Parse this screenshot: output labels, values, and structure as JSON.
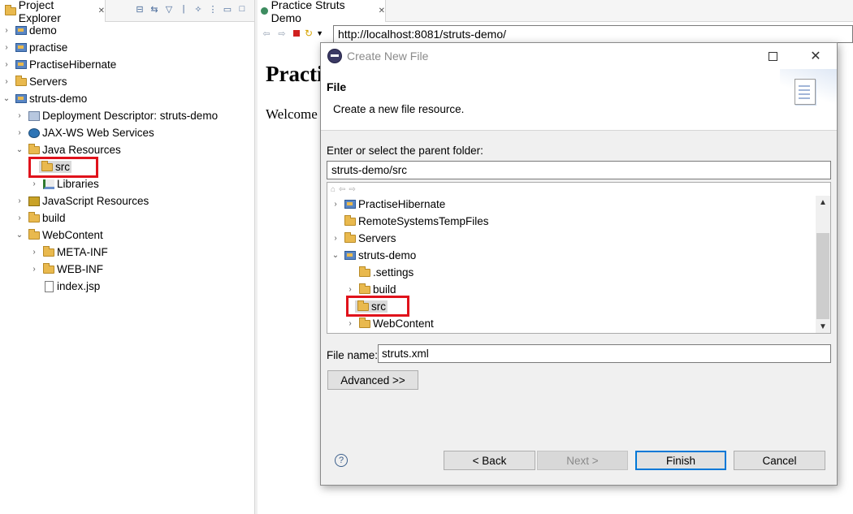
{
  "explorer": {
    "tab_label": "Project Explorer",
    "tab_close": "✕",
    "items": [
      {
        "label": "demo",
        "twisty": "›",
        "icon": "project-icon"
      },
      {
        "label": "practise",
        "twisty": "›",
        "icon": "project-icon"
      },
      {
        "label": "PractiseHibernate",
        "twisty": "›",
        "icon": "project-icon"
      },
      {
        "label": "Servers",
        "twisty": "›",
        "icon": "folder-icon"
      },
      {
        "label": "struts-demo",
        "twisty": "⌄",
        "icon": "project-icon"
      },
      {
        "label": "Deployment Descriptor: struts-demo",
        "twisty": "›",
        "icon": "deployment-descriptor-icon"
      },
      {
        "label": "JAX-WS Web Services",
        "twisty": "›",
        "icon": "web-services-icon"
      },
      {
        "label": "Java Resources",
        "twisty": "⌄",
        "icon": "java-resources-icon"
      },
      {
        "label": "src",
        "twisty": "",
        "icon": "source-folder-icon"
      },
      {
        "label": "Libraries",
        "twisty": "›",
        "icon": "libraries-icon"
      },
      {
        "label": "JavaScript Resources",
        "twisty": "›",
        "icon": "javascript-resources-icon"
      },
      {
        "label": "build",
        "twisty": "›",
        "icon": "folder-icon"
      },
      {
        "label": "WebContent",
        "twisty": "⌄",
        "icon": "folder-icon"
      },
      {
        "label": "META-INF",
        "twisty": "›",
        "icon": "folder-icon"
      },
      {
        "label": "WEB-INF",
        "twisty": "›",
        "icon": "folder-icon"
      },
      {
        "label": "index.jsp",
        "twisty": "",
        "icon": "jsp-file-icon"
      }
    ]
  },
  "browser": {
    "tab_label": "Practice Struts Demo",
    "tab_close": "✕",
    "url": "http://localhost:8081/struts-demo/",
    "page_heading": "Practic",
    "page_text": "Welcome"
  },
  "dialog": {
    "title": "Create New File",
    "banner_title": "File",
    "banner_message": "Create a new file resource.",
    "parent_label": "Enter or select the parent folder:",
    "parent_value": "struts-demo/src",
    "tree_items": [
      {
        "label": "PractiseHibernate",
        "twisty": "›"
      },
      {
        "label": "RemoteSystemsTempFiles",
        "twisty": ""
      },
      {
        "label": "Servers",
        "twisty": "›"
      },
      {
        "label": "struts-demo",
        "twisty": "⌄"
      },
      {
        "label": ".settings",
        "twisty": ""
      },
      {
        "label": "build",
        "twisty": "›"
      },
      {
        "label": "src",
        "twisty": ""
      },
      {
        "label": "WebContent",
        "twisty": "›"
      }
    ],
    "file_name_label": "File name:",
    "file_name_value": "struts.xml",
    "advanced_label": "Advanced >>",
    "back_label": "< Back",
    "next_label": "Next >",
    "finish_label": "Finish",
    "cancel_label": "Cancel",
    "help_glyph": "?"
  },
  "colors": {
    "highlight_box": "#e0121b",
    "folder": "#e9b94e",
    "default_button_border": "#0078d7"
  }
}
